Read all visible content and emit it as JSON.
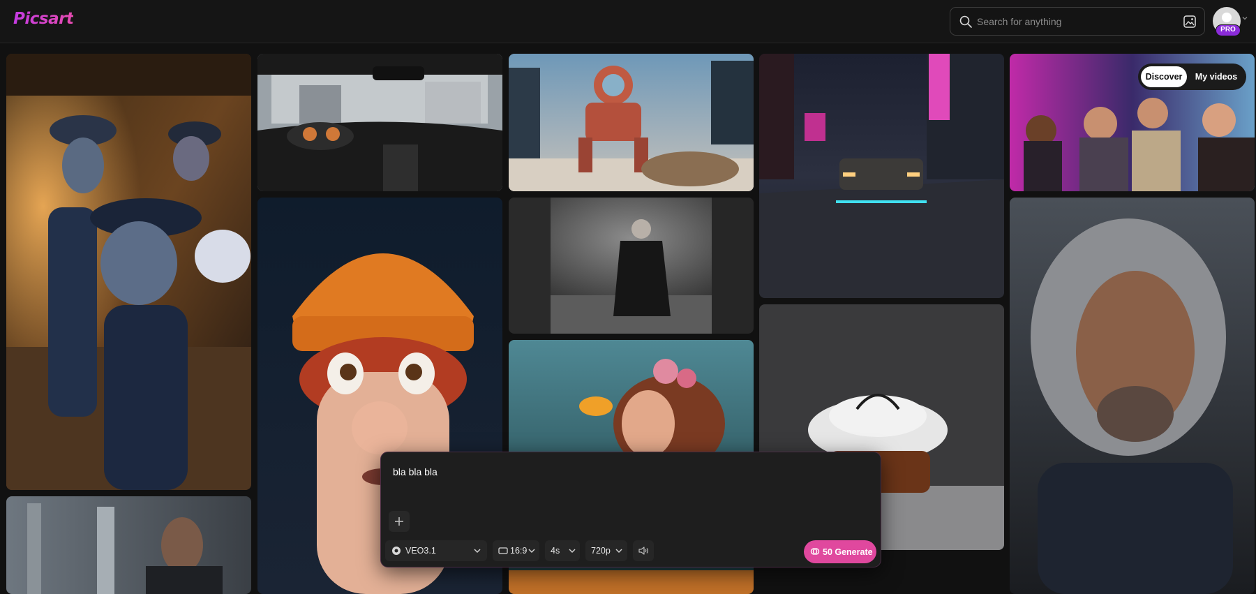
{
  "app": {
    "logo_text": "Picsart",
    "brand_color": "#d236e6"
  },
  "header": {
    "search": {
      "placeholder": "Search for anything",
      "icon": "search-icon",
      "image_icon": "image-search-icon"
    },
    "profile": {
      "badge": "PRO",
      "badge_color": "#8b2bd9"
    }
  },
  "view_toggle": {
    "options": [
      {
        "label": "Discover",
        "active": true
      },
      {
        "label": "My videos",
        "active": false
      }
    ]
  },
  "gallery": {
    "tiles": [
      {
        "name": "tile-cartoon-family"
      },
      {
        "name": "tile-car-dashboard"
      },
      {
        "name": "tile-robot-mech"
      },
      {
        "name": "tile-neon-car"
      },
      {
        "name": "tile-party-crowd"
      },
      {
        "name": "tile-beanie-character"
      },
      {
        "name": "tile-suited-man-stairs"
      },
      {
        "name": "tile-underwater-portrait"
      },
      {
        "name": "tile-pearls-bag"
      },
      {
        "name": "tile-long-hair-man"
      },
      {
        "name": "tile-church-man"
      }
    ]
  },
  "prompt": {
    "text": "bla bla bla",
    "add_icon": "plus-icon",
    "model": {
      "label": "VEO3.1",
      "icon": "model-icon"
    },
    "aspect_ratio": {
      "label": "16:9",
      "icon": "aspect-ratio-icon"
    },
    "duration": {
      "label": "4s"
    },
    "resolution": {
      "label": "720p"
    },
    "audio_icon": "speaker-icon",
    "generate": {
      "label": "50 Generate",
      "color": "#e0489e",
      "icon": "credits-icon"
    }
  }
}
